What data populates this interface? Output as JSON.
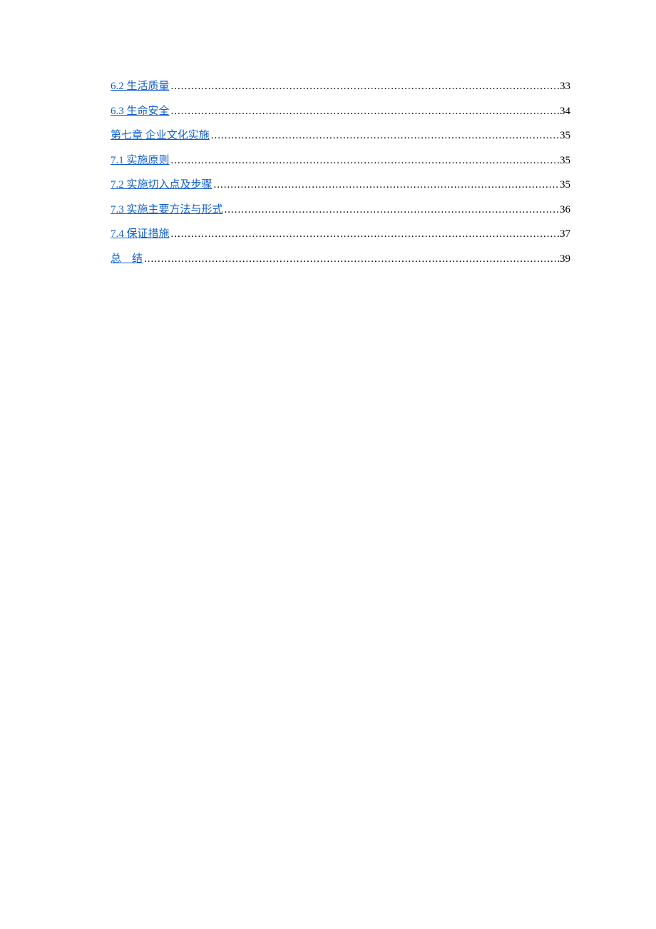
{
  "toc": {
    "entries": [
      {
        "label": "6.2  生活质量",
        "page": "33"
      },
      {
        "label": "6.3  生命安全",
        "page": "34"
      },
      {
        "label": "第七章  企业文化实施",
        "page": "35"
      },
      {
        "label": "7.1  实施原则",
        "page": "35"
      },
      {
        "label": "7.2 实施切入点及步骤",
        "page": "35"
      },
      {
        "label": "7.3 实施主要方法与形式",
        "page": "36"
      },
      {
        "label": "7.4 保证措施",
        "page": "37"
      },
      {
        "label": "总　结",
        "page": "39"
      }
    ]
  }
}
